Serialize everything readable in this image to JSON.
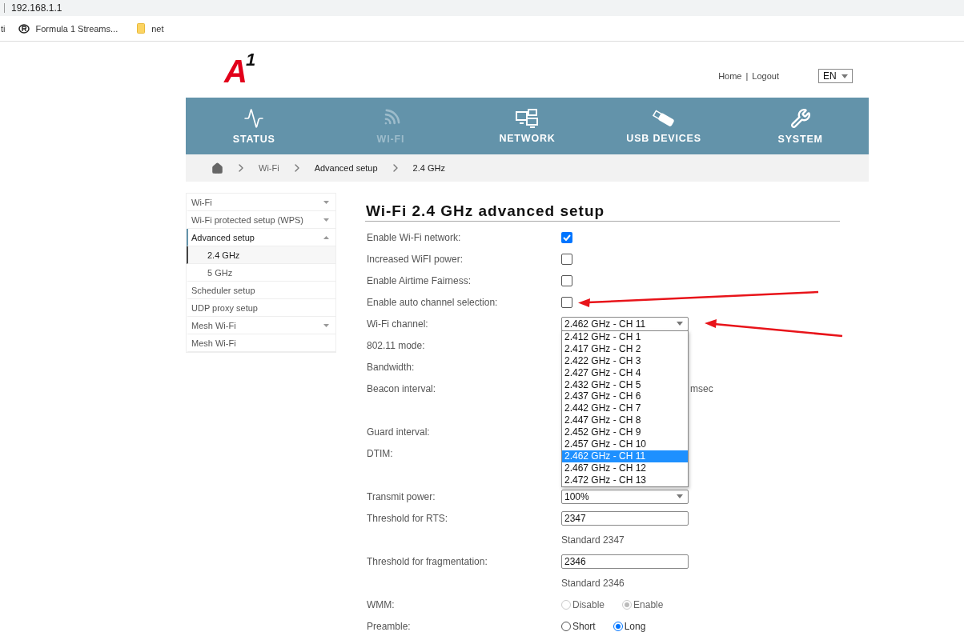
{
  "browser": {
    "address": "192.168.1.1",
    "bookmarks": [
      {
        "kind": "cut",
        "label": "ti"
      },
      {
        "kind": "site",
        "label": "Formula 1 Streams..."
      },
      {
        "kind": "folder",
        "label": "net"
      }
    ]
  },
  "header": {
    "logo": {
      "letter": "A",
      "digit": "1"
    },
    "links": [
      "Home",
      "Logout"
    ],
    "separator": "|",
    "language": "EN"
  },
  "nav": [
    {
      "label": "STATUS",
      "selected": false
    },
    {
      "label": "WI-FI",
      "selected": true
    },
    {
      "label": "NETWORK",
      "selected": false
    },
    {
      "label": "USB DEVICES",
      "selected": false
    },
    {
      "label": "SYSTEM",
      "selected": false
    }
  ],
  "breadcrumb": [
    {
      "label": "Wi-Fi",
      "link": true
    },
    {
      "label": "Advanced setup",
      "link": false
    },
    {
      "label": "2.4 GHz",
      "link": false
    }
  ],
  "sidebar": {
    "items": [
      {
        "label": "Wi-Fi",
        "expanded": false,
        "selected": false
      },
      {
        "label": "Wi-Fi protected setup (WPS)",
        "expanded": false,
        "selected": false
      },
      {
        "label": "Advanced setup",
        "expanded": true,
        "selected": true,
        "children": [
          {
            "label": "2.4 GHz",
            "selected": true
          },
          {
            "label": "5 GHz",
            "selected": false
          }
        ]
      },
      {
        "label": "Scheduler setup",
        "selected": false
      },
      {
        "label": "UDP proxy setup",
        "selected": false
      },
      {
        "label": "Mesh Wi-Fi",
        "expanded": false,
        "selected": false
      },
      {
        "label": "Mesh Wi-Fi",
        "selected": false
      }
    ]
  },
  "form": {
    "title": "Wi-Fi 2.4 GHz advanced setup",
    "rows": [
      {
        "kind": "checkbox",
        "label": "Enable Wi-Fi network:",
        "checked": true
      },
      {
        "kind": "checkbox",
        "label": "Increased WiFI power:",
        "checked": false
      },
      {
        "kind": "checkbox",
        "label": "Enable Airtime Fairness:",
        "checked": false
      },
      {
        "kind": "checkbox",
        "label": "Enable auto channel selection:",
        "checked": false
      },
      {
        "kind": "dropdown",
        "label": "Wi-Fi channel:",
        "value": "2.462 GHz - CH 11",
        "options": [
          {
            "label": "2.412 GHz - CH 1",
            "selected": false
          },
          {
            "label": "2.417 GHz - CH 2",
            "selected": false
          },
          {
            "label": "2.422 GHz - CH 3",
            "selected": false
          },
          {
            "label": "2.427 GHz - CH 4",
            "selected": false
          },
          {
            "label": "2.432 GHz - CH 5",
            "selected": false
          },
          {
            "label": "2.437 GHz - CH 6",
            "selected": false
          },
          {
            "label": "2.442 GHz - CH 7",
            "selected": false
          },
          {
            "label": "2.447 GHz - CH 8",
            "selected": false
          },
          {
            "label": "2.452 GHz - CH 9",
            "selected": false
          },
          {
            "label": "2.457 GHz - CH 10",
            "selected": false
          },
          {
            "label": "2.462 GHz - CH 11",
            "selected": true
          },
          {
            "label": "2.467 GHz - CH 12",
            "selected": false
          },
          {
            "label": "2.472 GHz - CH 13",
            "selected": false
          }
        ]
      },
      {
        "kind": "covered",
        "label": "802.11 mode:"
      },
      {
        "kind": "covered",
        "label": "Bandwidth:"
      },
      {
        "kind": "covered",
        "label": "Beacon interval:",
        "suffix": "msec",
        "extra_line": true
      },
      {
        "kind": "covered",
        "label": "Guard interval:"
      },
      {
        "kind": "covered",
        "label": "DTIM:",
        "extra_line": true
      },
      {
        "kind": "select",
        "label": "Transmit power:",
        "value": "100%"
      },
      {
        "kind": "text",
        "label": "Threshold for RTS:",
        "value": "2347",
        "note": "Standard 2347"
      },
      {
        "kind": "text",
        "label": "Threshold for fragmentation:",
        "value": "2346",
        "note": "Standard 2346"
      },
      {
        "kind": "radio",
        "label": "WMM:",
        "options": [
          {
            "label": "Disable",
            "selected": false,
            "disabled": true
          },
          {
            "label": "Enable",
            "selected": true,
            "disabled": true
          }
        ]
      },
      {
        "kind": "radio",
        "label": "Preamble:",
        "options": [
          {
            "label": "Short",
            "selected": false,
            "disabled": false
          },
          {
            "label": "Long",
            "selected": true,
            "disabled": false
          }
        ]
      }
    ]
  }
}
